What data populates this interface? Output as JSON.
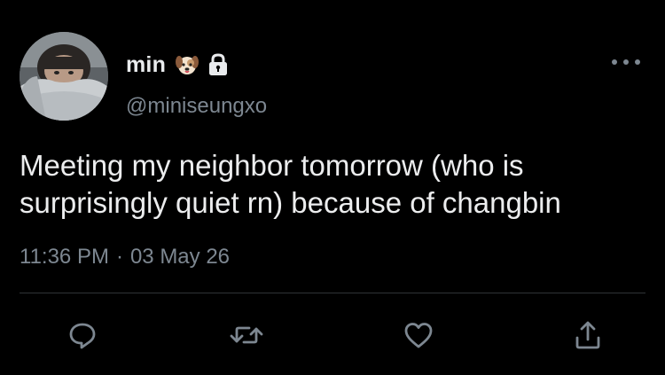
{
  "user": {
    "display_name": "min",
    "name_emoji_icon": "puppy-face-emoji",
    "protected_icon": "lock-icon",
    "handle": "@miniseungxo"
  },
  "tweet": {
    "text_line1": "Meeting my neighbor tomorrow (who is",
    "text_line2": "surprisingly quiet rn) because of changbin",
    "time": "11:36 PM",
    "separator": "·",
    "date": "03 May 26"
  },
  "actions": {
    "reply_icon": "reply-icon",
    "retweet_icon": "retweet-icon",
    "like_icon": "heart-icon",
    "share_icon": "share-icon"
  },
  "colors": {
    "background": "#000000",
    "text": "#ecedee",
    "secondary": "#7d8791",
    "divider": "#2f3336"
  }
}
